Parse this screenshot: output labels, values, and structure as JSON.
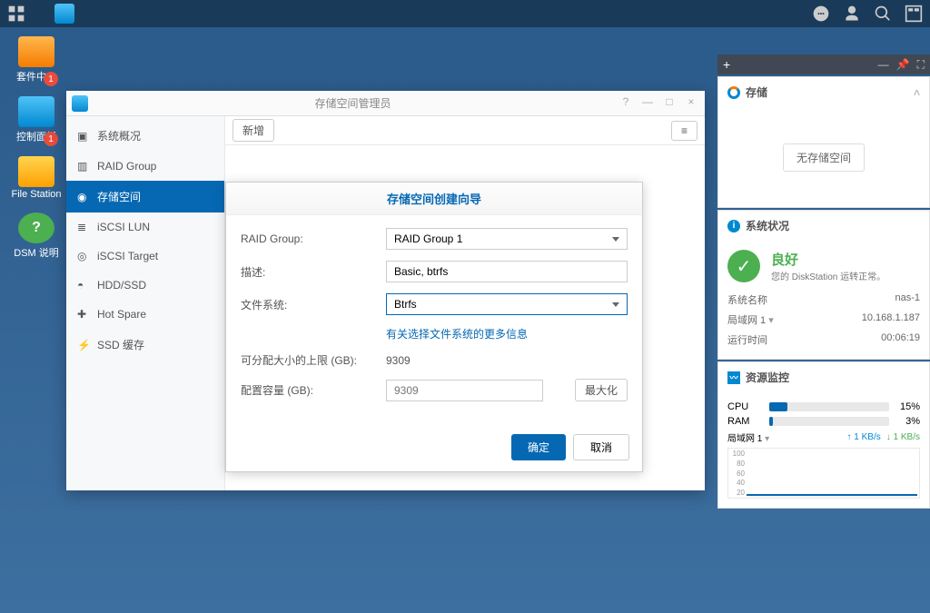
{
  "taskbar": {},
  "desktop": {
    "pkg_center": "套件中心",
    "pkg_badge": "1",
    "control_panel": "控制面板",
    "cp_badge": "1",
    "file_station": "File Station",
    "dsm_help": "DSM 说明"
  },
  "window": {
    "title": "存储空间管理员",
    "new_btn": "新增",
    "sidebar": {
      "overview": "系统概况",
      "raid": "RAID Group",
      "volume": "存储空间",
      "iscsi_lun": "iSCSI LUN",
      "iscsi_target": "iSCSI Target",
      "hdd": "HDD/SSD",
      "hotspare": "Hot Spare",
      "ssdcache": "SSD 缓存"
    }
  },
  "wizard": {
    "title": "存储空间创建向导",
    "raid_group_label": "RAID Group:",
    "raid_group_value": "RAID Group 1",
    "desc_label": "描述:",
    "desc_value": "Basic, btrfs",
    "fs_label": "文件系统:",
    "fs_value": "Btrfs",
    "fs_link": "有关选择文件系统的更多信息",
    "alloc_label": "可分配大小的上限 (GB):",
    "alloc_value": "9309",
    "size_label": "配置容量 (GB):",
    "size_placeholder": "9309",
    "max_btn": "最大化",
    "ok": "确定",
    "cancel": "取消"
  },
  "widgets": {
    "storage": {
      "title": "存储",
      "empty": "无存储空间"
    },
    "status": {
      "title": "系统状况",
      "good": "良好",
      "good_desc": "您的 DiskStation 运转正常。",
      "sys_name_label": "系统名称",
      "sys_name": "nas-1",
      "lan_label": "局域网 1",
      "lan_value": "10.168.1.187",
      "uptime_label": "运行时间",
      "uptime_value": "00:06:19"
    },
    "monitor": {
      "title": "资源监控",
      "cpu_label": "CPU",
      "cpu_pct": "15%",
      "ram_label": "RAM",
      "ram_pct": "3%",
      "net_label": "局域网 1",
      "up": "1 KB/s",
      "down": "1 KB/s"
    }
  },
  "chart_data": {
    "type": "line",
    "ylim": [
      0,
      100
    ],
    "yticks": [
      100,
      80,
      60,
      40,
      20
    ],
    "series": [
      {
        "name": "局域网 1",
        "values": [
          2,
          2,
          2,
          2,
          2,
          2,
          2,
          2,
          2,
          2
        ]
      }
    ]
  }
}
